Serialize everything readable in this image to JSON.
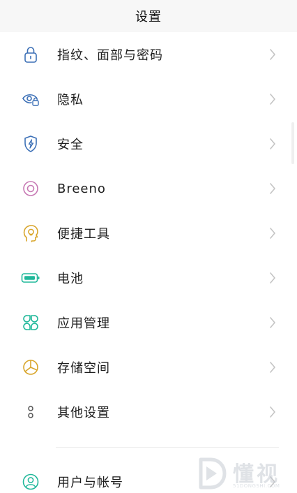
{
  "header": {
    "title": "设置"
  },
  "items": [
    {
      "label": "指纹、面部与密码",
      "icon": "lock-icon",
      "color": "#3b6fb6"
    },
    {
      "label": "隐私",
      "icon": "privacy-eye-icon",
      "color": "#3b6fb6"
    },
    {
      "label": "安全",
      "icon": "shield-bolt-icon",
      "color": "#3b6fb6"
    },
    {
      "label": "Breeno",
      "icon": "breeno-circle-icon",
      "color": "#c779b4"
    },
    {
      "label": "便捷工具",
      "icon": "head-bulb-icon",
      "color": "#d8a52a"
    },
    {
      "label": "电池",
      "icon": "battery-icon",
      "color": "#20b89a"
    },
    {
      "label": "应用管理",
      "icon": "app-grid-icon",
      "color": "#20b89a"
    },
    {
      "label": "存储空间",
      "icon": "pie-storage-icon",
      "color": "#d8a52a"
    },
    {
      "label": "其他设置",
      "icon": "dots-vertical-icon",
      "color": "#555555"
    },
    {
      "label": "用户与帐号",
      "icon": "user-icon",
      "color": "#20b89a"
    }
  ],
  "watermark": {
    "chars": "懂视",
    "url": "51DONGSHI.COM"
  }
}
